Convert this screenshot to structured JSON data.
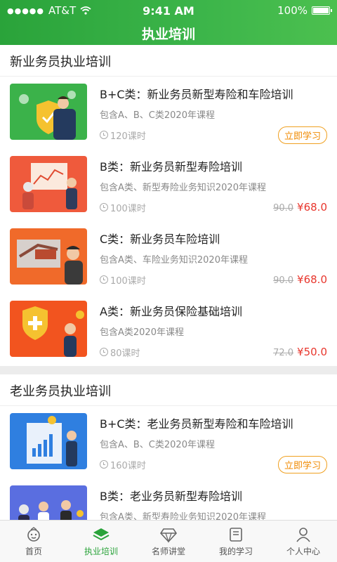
{
  "status": {
    "carrier": "AT&T",
    "time": "9:41 AM",
    "battery": "100%"
  },
  "header": {
    "title": "执业培训"
  },
  "sections": [
    {
      "title": "新业务员执业培训",
      "courses": [
        {
          "title": "B+C类：新业务员新型寿险和车险培训",
          "subtitle": "包含A、B、C类2020年课程",
          "hours": "120课时",
          "action": "立即学习"
        },
        {
          "title": "B类：新业务员新型寿险培训",
          "subtitle": "包含A类、新型寿险业务知识2020年课程",
          "hours": "100课时",
          "old_price": "90.0",
          "price": "¥68.0"
        },
        {
          "title": "C类：新业务员车险培训",
          "subtitle": "包含A类、车险业务知识2020年课程",
          "hours": "100课时",
          "old_price": "90.0",
          "price": "¥68.0"
        },
        {
          "title": "A类：新业务员保险基础培训",
          "subtitle": "包含A类2020年课程",
          "hours": "80课时",
          "old_price": "72.0",
          "price": "¥50.0"
        }
      ]
    },
    {
      "title": "老业务员执业培训",
      "courses": [
        {
          "title": "B+C类：老业务员新型寿险和车险培训",
          "subtitle": "包含A、B、C类2020年课程",
          "hours": "160课时",
          "action": "立即学习"
        },
        {
          "title": "B类：老业务员新型寿险培训",
          "subtitle": "包含A类、新型寿险业务知识2020年课程"
        }
      ]
    }
  ],
  "tabs": [
    {
      "label": "首页",
      "icon": "home-face-icon"
    },
    {
      "label": "执业培训",
      "icon": "layers-icon"
    },
    {
      "label": "名师讲堂",
      "icon": "diamond-icon"
    },
    {
      "label": "我的学习",
      "icon": "book-icon"
    },
    {
      "label": "个人中心",
      "icon": "person-icon"
    }
  ],
  "colors": {
    "brand_green": "#2aa33a",
    "price_red": "#e8362d",
    "button_orange": "#f08a00"
  }
}
